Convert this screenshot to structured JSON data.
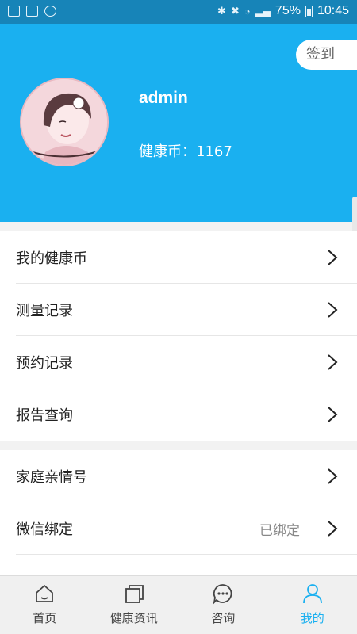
{
  "status_bar": {
    "battery": "75%",
    "time": "10:45"
  },
  "header": {
    "checkin_label": "签到",
    "username": "admin",
    "coins_label": "健康币：1167"
  },
  "menu_group_1": [
    {
      "label": "我的健康币"
    },
    {
      "label": "测量记录"
    },
    {
      "label": "预约记录"
    },
    {
      "label": "报告查询"
    }
  ],
  "menu_group_2": [
    {
      "label": "家庭亲情号",
      "value": ""
    },
    {
      "label": "微信绑定",
      "value": "已绑定"
    }
  ],
  "tabbar": {
    "items": [
      {
        "label": "首页",
        "icon": "home-icon"
      },
      {
        "label": "健康资讯",
        "icon": "news-icon"
      },
      {
        "label": "咨询",
        "icon": "chat-icon"
      },
      {
        "label": "我的",
        "icon": "user-icon"
      }
    ],
    "active_index": 3,
    "active_color": "#1ab0f0"
  },
  "colors": {
    "brand": "#1ab0f0",
    "status_bar": "#1784b8"
  }
}
